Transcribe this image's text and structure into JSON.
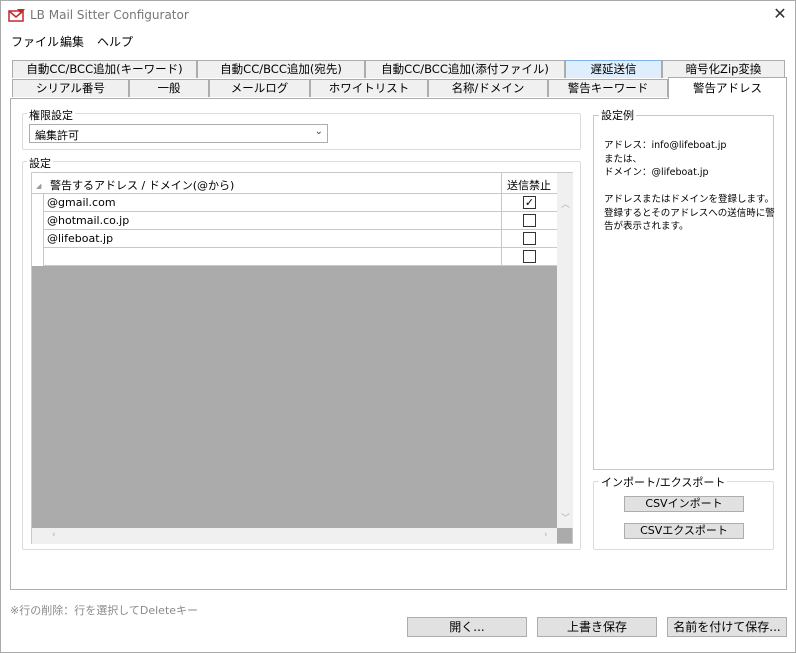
{
  "window": {
    "title": "LB Mail Sitter Configurator",
    "close_glyph": "✕"
  },
  "menu": [
    "ファイル",
    "編集",
    "ヘルプ"
  ],
  "tabs_row1": [
    "自動CC/BCC追加(キーワード)",
    "自動CC/BCC追加(宛先)",
    "自動CC/BCC追加(添付ファイル)",
    "遅延送信",
    "暗号化Zip変換"
  ],
  "tabs_row2": [
    "シリアル番号",
    "一般",
    "メールログ",
    "ホワイトリスト",
    "名称/ドメイン",
    "警告キーワード",
    "警告アドレス"
  ],
  "active_tab": "警告アドレス",
  "permission": {
    "group_label": "権限設定",
    "selected": "編集許可",
    "arrow": "⌄"
  },
  "settings": {
    "group_label": "設定",
    "columns": {
      "address": "警告するアドレス / ドメイン(@から)",
      "block": "送信禁止"
    },
    "rows": [
      {
        "address": "@gmail.com",
        "block": true
      },
      {
        "address": "@hotmail.co.jp",
        "block": false
      },
      {
        "address": "@lifeboat.jp",
        "block": false
      },
      {
        "address": "",
        "block": false
      }
    ],
    "check_glyph": "✓"
  },
  "example": {
    "group_label": "設定例",
    "lines": [
      "アドレス：info@lifeboat.jp",
      "または、",
      "ドメイン：@lifeboat.jp",
      "",
      "アドレスまたはドメインを登録します。",
      "登録するとそのアドレスへの送信時に警",
      "告が表示されます。"
    ]
  },
  "import_export": {
    "group_label": "インポート/エクスポート",
    "import_label": "CSVインポート",
    "export_label": "CSVエクスポート"
  },
  "footer": {
    "note": "※行の削除：行を選択してDeleteキー",
    "open_label": "開く...",
    "save_label": "上書き保存",
    "save_as_label": "名前を付けて保存..."
  },
  "colors": {
    "tab_highlight": "#dfeefc",
    "button_bg": "#e1e1e1",
    "footer_note": "#8a8a8a"
  },
  "icons": {
    "app": "lb-app-icon",
    "close": "close-icon"
  }
}
